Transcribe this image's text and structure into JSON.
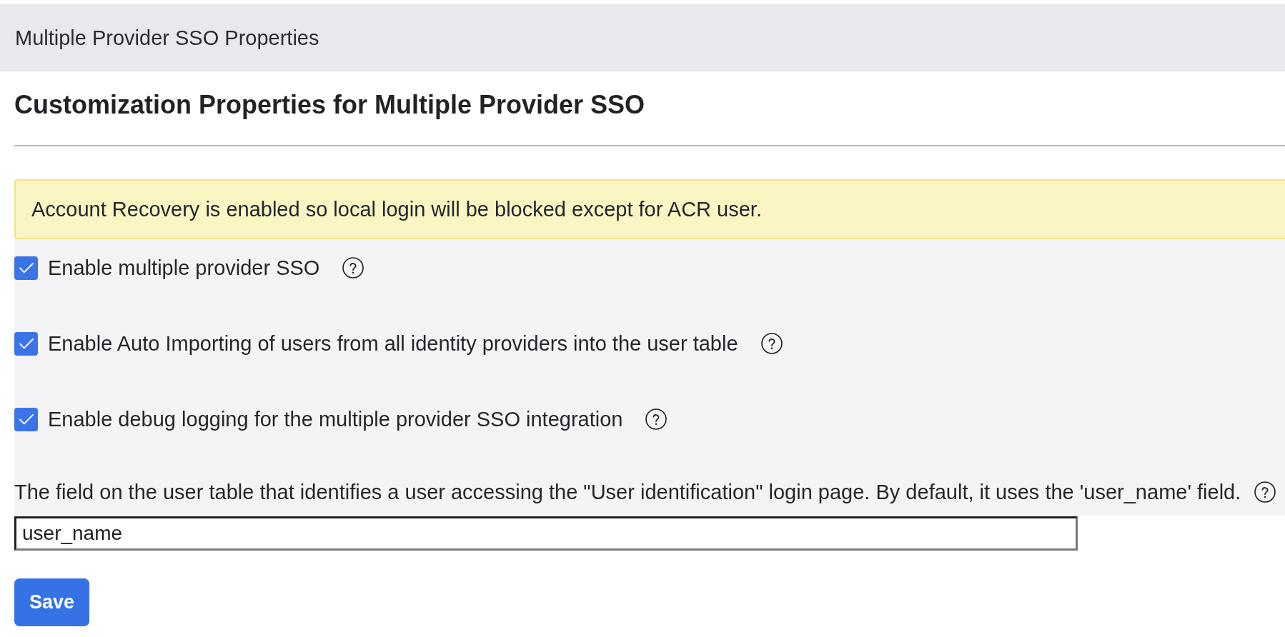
{
  "header": {
    "title": "Multiple Provider SSO Properties"
  },
  "page": {
    "heading": "Customization Properties for Multiple Provider SSO"
  },
  "alert": {
    "kind": "warning",
    "message": "Account Recovery is enabled so local login will be blocked except for ACR user."
  },
  "options": [
    {
      "kind": "checkbox",
      "label": "Enable multiple provider SSO",
      "checked": true
    },
    {
      "kind": "checkbox",
      "label": "Enable Auto Importing of users from all identity providers into the user table",
      "checked": true
    },
    {
      "kind": "checkbox",
      "label": "Enable debug logging for the multiple provider SSO integration",
      "checked": true
    }
  ],
  "field": {
    "label": "The field on the user table that identifies a user accessing the \"User identification\" login page. By default, it uses the 'user_name' field.",
    "value": "user_name"
  },
  "buttons": [
    {
      "kind": "primary",
      "label": "Save"
    }
  ]
}
